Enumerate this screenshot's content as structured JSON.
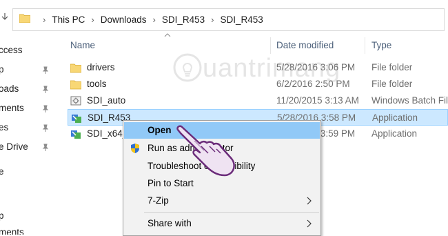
{
  "breadcrumb": [
    "This PC",
    "Downloads",
    "SDI_R453",
    "SDI_R453"
  ],
  "nav_items": [
    "ccess",
    "p",
    "oads",
    "ments",
    "es",
    "e Drive",
    "e",
    "p",
    "ments"
  ],
  "columns": {
    "name": "Name",
    "date": "Date modified",
    "type": "Type"
  },
  "files": [
    {
      "name": "drivers",
      "date": "5/28/2016 3:06 PM",
      "type": "File folder",
      "icon": "folder-icon"
    },
    {
      "name": "tools",
      "date": "6/2/2016 2:50 PM",
      "type": "File folder",
      "icon": "folder-icon"
    },
    {
      "name": "SDI_auto",
      "date": "11/20/2015 3:13 AM",
      "type": "Windows Batch Fil",
      "icon": "batch-file-icon"
    },
    {
      "name": "SDI_R453",
      "date": "5/28/2016 3:58 PM",
      "type": "Application",
      "icon": "application-icon",
      "selected": true
    },
    {
      "name": "SDI_x64_",
      "date": "5/28/2016 3:59 PM",
      "type": "Application",
      "icon": "application-icon"
    }
  ],
  "context_menu": {
    "items": [
      {
        "label": "Open",
        "bold": true,
        "highlighted": true
      },
      {
        "label": "Run as administrator",
        "icon": "uac-shield-icon"
      },
      {
        "label": "Troubleshoot compatibility"
      },
      {
        "label": "Pin to Start"
      },
      {
        "label": "7-Zip",
        "submenu": true
      },
      {
        "label": "Share with",
        "submenu": true
      }
    ]
  },
  "watermark": "uantrimang",
  "colors": {
    "selection": "#cce8ff",
    "menu_highlight": "#91c9f7",
    "folder": "#f8d775",
    "hand": "#6b2c7a"
  }
}
